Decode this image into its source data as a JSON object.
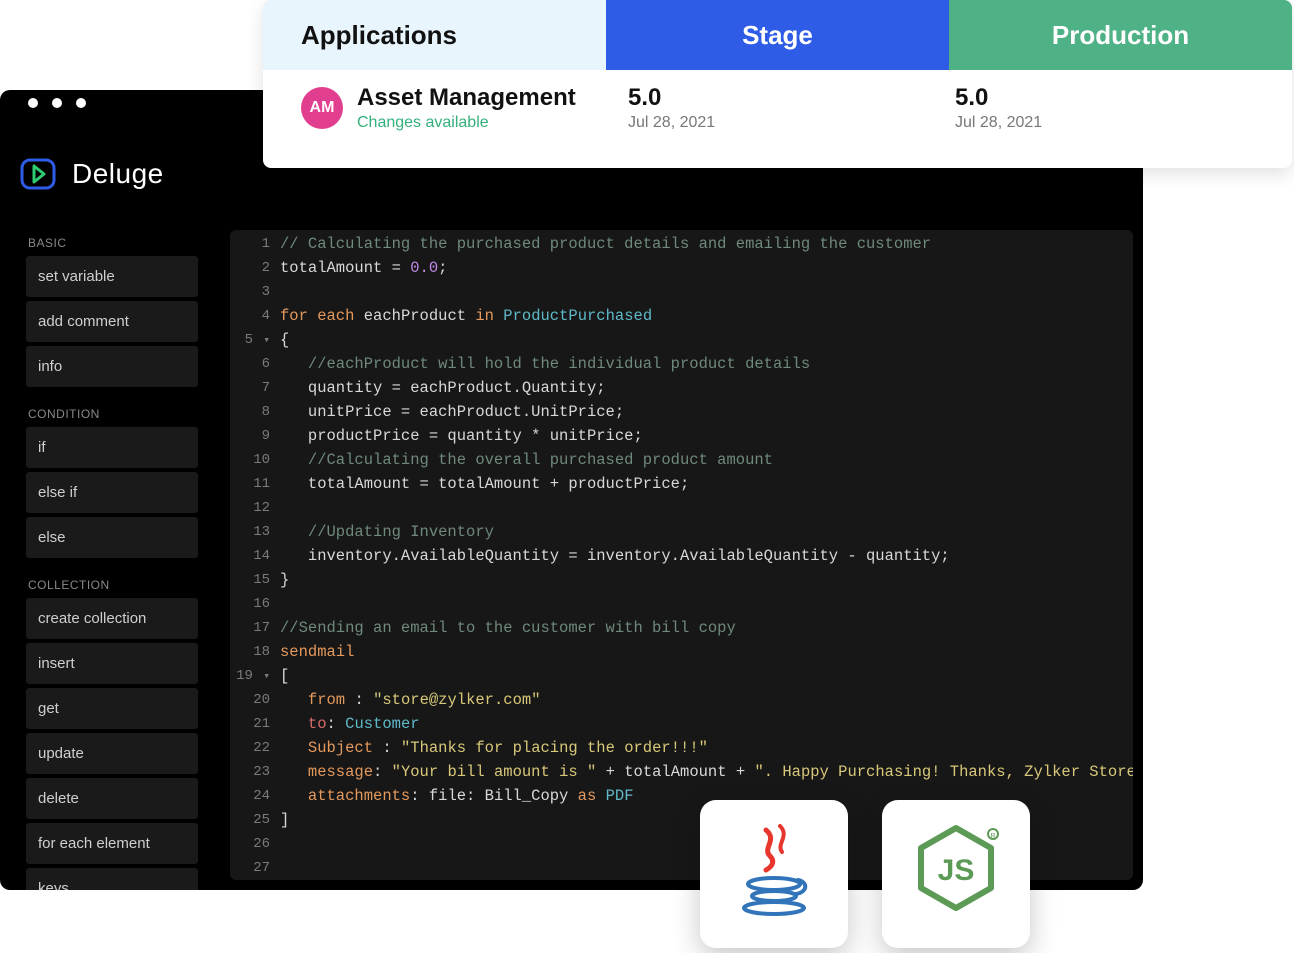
{
  "appBar": {
    "cols": {
      "apps": "Applications",
      "stage": "Stage",
      "prod": "Production"
    },
    "row": {
      "avatar": "AM",
      "name": "Asset Management",
      "changes": "Changes available",
      "stage": {
        "version": "5.0",
        "date": "Jul 28, 2021"
      },
      "prod": {
        "version": "5.0",
        "date": "Jul 28, 2021"
      }
    }
  },
  "deluge": {
    "name": "Deluge"
  },
  "sidebar": {
    "sections": [
      {
        "title": "BASIC",
        "items": [
          "set variable",
          "add comment",
          "info"
        ]
      },
      {
        "title": "CONDITION",
        "items": [
          "if",
          "else if",
          "else"
        ]
      },
      {
        "title": "COLLECTION",
        "items": [
          "create collection",
          "insert",
          "get",
          "update",
          "delete",
          "for each element",
          "keys"
        ]
      }
    ]
  },
  "code": {
    "lines": [
      {
        "n": "1",
        "html": "<span class='c-comment'>// Calculating the purchased product details and emailing the customer</span>"
      },
      {
        "n": "2",
        "html": "<span class='c-ident'>totalAmount = </span><span class='c-num'>0.0</span><span class='c-ident'>;</span>"
      },
      {
        "n": "3",
        "html": ""
      },
      {
        "n": "4",
        "html": "<span class='c-keyword'>for each</span> <span class='c-ident'>eachProduct</span> <span class='c-in'>in</span> <span class='c-type'>ProductPurchased</span>"
      },
      {
        "n": "5",
        "fold": true,
        "html": "<span class='c-brace'>{</span>"
      },
      {
        "n": "6",
        "html": "   <span class='c-comment'>//eachProduct will hold the individual product details</span>"
      },
      {
        "n": "7",
        "html": "   <span class='c-ident'>quantity = eachProduct.Quantity;</span>"
      },
      {
        "n": "8",
        "html": "   <span class='c-ident'>unitPrice = eachProduct.UnitPrice;</span>"
      },
      {
        "n": "9",
        "html": "   <span class='c-ident'>productPrice = quantity * unitPrice;</span>"
      },
      {
        "n": "10",
        "html": "   <span class='c-comment'>//Calculating the overall purchased product amount</span>"
      },
      {
        "n": "11",
        "html": "   <span class='c-ident'>totalAmount = totalAmount + productPrice;</span>"
      },
      {
        "n": "12",
        "html": ""
      },
      {
        "n": "13",
        "html": "   <span class='c-comment'>//Updating Inventory</span>"
      },
      {
        "n": "14",
        "html": "   <span class='c-ident'>inventory.AvailableQuantity = inventory.AvailableQuantity - quantity;</span>"
      },
      {
        "n": "15",
        "html": "<span class='c-brace'>}</span>"
      },
      {
        "n": "16",
        "html": ""
      },
      {
        "n": "17",
        "html": "<span class='c-comment'>//Sending an email to the customer with bill copy</span>"
      },
      {
        "n": "18",
        "html": "<span class='c-mail'>sendmail</span>"
      },
      {
        "n": "19",
        "fold": true,
        "html": "<span class='c-brace'>[</span>"
      },
      {
        "n": "20",
        "html": "   <span class='c-mailkey'>from</span> <span class='c-ident'>:</span> <span class='c-str'>\"store@zylker.com\"</span>"
      },
      {
        "n": "21",
        "html": "   <span class='c-mailto'>to</span><span class='c-ident'>:</span> <span class='c-customer'>Customer</span>"
      },
      {
        "n": "22",
        "html": "   <span class='c-mailkey'>Subject</span> <span class='c-ident'>:</span> <span class='c-str'>\"Thanks for placing the order!!!\"</span>"
      },
      {
        "n": "23",
        "html": "   <span class='c-mailkey'>message</span><span class='c-ident'>:</span> <span class='c-str'>\"Your bill amount is \"</span> <span class='c-ident'>+ totalAmount + </span><span class='c-str'>\". Happy Purchasing! Thanks, Zylker Store\"</span>"
      },
      {
        "n": "24",
        "html": "   <span class='c-mailkey'>attachments</span><span class='c-ident'>: file: Bill_Copy </span><span class='c-as'>as</span> <span class='c-pdf'>PDF</span>"
      },
      {
        "n": "25",
        "html": "<span class='c-brace'>]</span>"
      },
      {
        "n": "26",
        "html": ""
      },
      {
        "n": "27",
        "html": ""
      }
    ]
  },
  "langCards": {
    "java": "Java",
    "node": "Node.js"
  }
}
